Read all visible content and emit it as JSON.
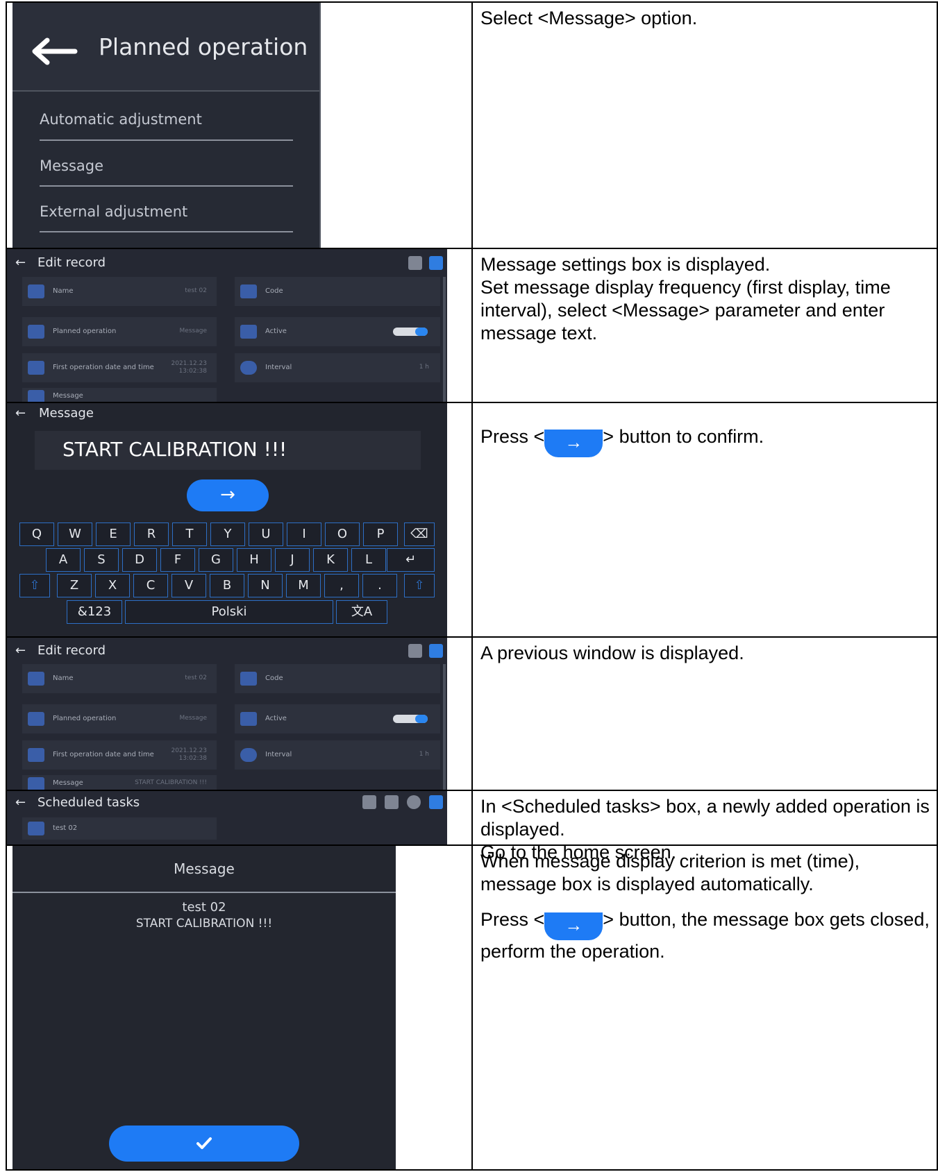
{
  "rows": [
    {
      "description": [
        "Select <Message> option."
      ],
      "screen": {
        "title": "Planned operation",
        "back_icon": "arrow-left-icon",
        "items": [
          "Automatic adjustment",
          "Message",
          "External adjustment"
        ]
      }
    },
    {
      "description": [
        "Message settings box is displayed.",
        "Set message display frequency (first display, time interval), select <Message> parameter and enter message text."
      ],
      "screen": {
        "title": "Edit record",
        "fields": [
          {
            "label": "Name",
            "value": "test 02"
          },
          {
            "label": "Code",
            "value": ""
          },
          {
            "label": "Planned operation",
            "value": "Message"
          },
          {
            "label": "Active",
            "value": ""
          },
          {
            "label": "First operation date and time",
            "value": "2021.12.23 13:02:38"
          },
          {
            "label": "Interval",
            "value": "1 h"
          },
          {
            "label": "Message",
            "value": ""
          }
        ],
        "active_toggle": 1
      }
    },
    {
      "description_pre": "Press <",
      "description_post": "> button to confirm.",
      "screen": {
        "title": "Message",
        "input_value": "START CALIBRATION !!!",
        "confirm_icon": "arrow-right-icon",
        "keyboard_rows": [
          [
            "Q",
            "W",
            "E",
            "R",
            "T",
            "Y",
            "U",
            "I",
            "O",
            "P"
          ],
          [
            "A",
            "S",
            "D",
            "F",
            "G",
            "H",
            "J",
            "K",
            "L"
          ],
          [
            "Z",
            "X",
            "C",
            "V",
            "B",
            "N",
            "M",
            ",",
            "."
          ]
        ],
        "backspace_icon": "backspace-icon",
        "enter_icon": "enter-icon",
        "shift_icon": "shift-icon",
        "symbols_key": "&123",
        "language_key": "Polski",
        "translate_icon": "translate-icon"
      }
    },
    {
      "description": [
        "A previous window is displayed."
      ],
      "screen": {
        "title": "Edit record",
        "fields": [
          {
            "label": "Name",
            "value": "test 02"
          },
          {
            "label": "Code",
            "value": ""
          },
          {
            "label": "Planned operation",
            "value": "Message"
          },
          {
            "label": "Active",
            "value": ""
          },
          {
            "label": "First operation date and time",
            "value": "2021.12.23 13:02:38"
          },
          {
            "label": "Interval",
            "value": "1 h"
          },
          {
            "label": "Message",
            "value": "START CALIBRATION !!!"
          }
        ],
        "active_toggle": 1
      }
    },
    {
      "description": [
        "In <Scheduled tasks> box, a newly added operation is displayed.",
        "Go to the home screen."
      ],
      "screen": {
        "title": "Scheduled tasks",
        "items": [
          "test 02"
        ]
      }
    },
    {
      "description_lines": [
        "When message display criterion is met (time), message box is displayed automatically."
      ],
      "description_pre": "Press <",
      "description_post": "> button, the message box gets closed, perform the operation.",
      "screen": {
        "title": "Message",
        "task_name": "test 02",
        "message_text": "START CALIBRATION !!!",
        "confirm_icon": "check-icon"
      }
    }
  ],
  "colors": {
    "screen_bg": "#252833",
    "card_bg": "#2d313d",
    "accent_blue": "#1e7bf5"
  }
}
